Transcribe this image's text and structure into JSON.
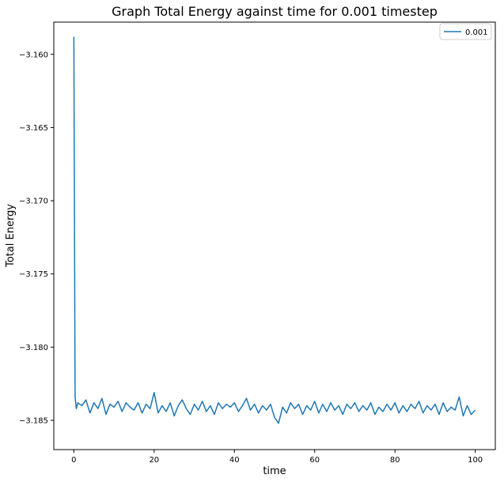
{
  "chart_data": {
    "type": "line",
    "title": "Graph Total Energy against time for 0.001 timestep",
    "xlabel": "time",
    "ylabel": "Total Energy",
    "xlim": [
      -5,
      105
    ],
    "ylim": [
      -3.187,
      -3.1578
    ],
    "xticks": [
      0,
      20,
      40,
      60,
      80,
      100
    ],
    "yticks": [
      -3.185,
      -3.18,
      -3.175,
      -3.17,
      -3.165,
      -3.16
    ],
    "xtick_labels": [
      "0",
      "20",
      "40",
      "60",
      "80",
      "100"
    ],
    "ytick_labels": [
      "−3.185",
      "−3.180",
      "−3.175",
      "−3.170",
      "−3.165",
      "−3.160"
    ],
    "grid": false,
    "legend_position": "top-right",
    "colors": {
      "series": "#1f77b4"
    },
    "series": [
      {
        "name": "0.001",
        "x": [
          0,
          0.3,
          0.6,
          1,
          2,
          3,
          4,
          5,
          6,
          7,
          8,
          9,
          10,
          11,
          12,
          13,
          14,
          15,
          16,
          17,
          18,
          19,
          20,
          21,
          22,
          23,
          24,
          25,
          26,
          27,
          28,
          29,
          30,
          31,
          32,
          33,
          34,
          35,
          36,
          37,
          38,
          39,
          40,
          41,
          42,
          43,
          44,
          45,
          46,
          47,
          48,
          49,
          50,
          51,
          52,
          53,
          54,
          55,
          56,
          57,
          58,
          59,
          60,
          61,
          62,
          63,
          64,
          65,
          66,
          67,
          68,
          69,
          70,
          71,
          72,
          73,
          74,
          75,
          76,
          77,
          78,
          79,
          80,
          81,
          82,
          83,
          84,
          85,
          86,
          87,
          88,
          89,
          90,
          91,
          92,
          93,
          94,
          95,
          96,
          97,
          98,
          99,
          100
        ],
        "values": [
          -3.1588,
          -3.1834,
          -3.1842,
          -3.1838,
          -3.184,
          -3.1836,
          -3.1845,
          -3.1838,
          -3.1842,
          -3.1835,
          -3.1846,
          -3.1839,
          -3.1841,
          -3.1837,
          -3.1844,
          -3.1838,
          -3.1841,
          -3.1843,
          -3.1838,
          -3.1845,
          -3.1839,
          -3.1842,
          -3.1831,
          -3.1845,
          -3.184,
          -3.1844,
          -3.1838,
          -3.1847,
          -3.184,
          -3.1836,
          -3.1842,
          -3.1846,
          -3.1839,
          -3.1843,
          -3.1837,
          -3.1844,
          -3.184,
          -3.1846,
          -3.1838,
          -3.1842,
          -3.1839,
          -3.1841,
          -3.1838,
          -3.1844,
          -3.184,
          -3.1835,
          -3.1843,
          -3.1839,
          -3.1845,
          -3.184,
          -3.1843,
          -3.1839,
          -3.1848,
          -3.1852,
          -3.1841,
          -3.1845,
          -3.1838,
          -3.1842,
          -3.1839,
          -3.1846,
          -3.184,
          -3.1843,
          -3.1837,
          -3.1845,
          -3.1839,
          -3.1844,
          -3.1838,
          -3.1843,
          -3.184,
          -3.1846,
          -3.1839,
          -3.1842,
          -3.1838,
          -3.1844,
          -3.184,
          -3.1843,
          -3.1838,
          -3.1846,
          -3.1841,
          -3.1844,
          -3.1839,
          -3.1843,
          -3.1838,
          -3.1845,
          -3.184,
          -3.1844,
          -3.1839,
          -3.1842,
          -3.1837,
          -3.1845,
          -3.184,
          -3.1843,
          -3.1839,
          -3.1846,
          -3.1838,
          -3.1844,
          -3.1841,
          -3.1843,
          -3.1834,
          -3.1847,
          -3.184,
          -3.1846,
          -3.1843
        ]
      }
    ]
  }
}
